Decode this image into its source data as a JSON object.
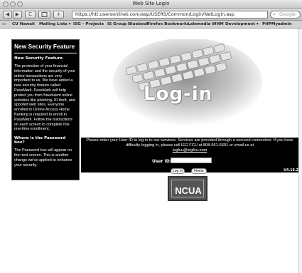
{
  "window": {
    "title": "Web Site Login"
  },
  "toolbar": {
    "url": "https://htt.usersonlinet.com/asp/USERS/Common/Login/NetLogin.asp",
    "search_placeholder": "Google",
    "back_label": "◀",
    "forward_label": "▶",
    "reload_label": "C",
    "add_label": "+"
  },
  "bookmarks": [
    {
      "label": "CU Hawaii"
    },
    {
      "label": "Mailing Lists ▾"
    },
    {
      "label": "ISG – Projects"
    },
    {
      "label": "IS Group Bluebook"
    },
    {
      "label": "Firefox Bookmarks"
    },
    {
      "label": "Lalemedia WHM"
    },
    {
      "label": "Development ▾"
    },
    {
      "label": "PHPMyadmin"
    }
  ],
  "sidebar": {
    "heading": "New Security Feature",
    "subheading_1": "New Security Feature",
    "body_1": "The protection of your financial information and the security of your online transactions are very important to us. We have added a new security feature called PassMark. PassMark will help protect you from fraudulent online activities like phishing, ID theft, and spoofed web sites. Everyone enrolled in Online Access Home Banking is required to enroll in PassMark. Follow the instructions on each screen to complete this one-time enrollment.",
    "subheading_2": "Where is the Password box?",
    "body_2": "The Password box will appear on the next screen. This is another change we've applied to enhance your security."
  },
  "hero": {
    "title": "Log-in"
  },
  "login": {
    "instructions": "Please enter your User ID to log in to our services. Services are provided through a secured connection. If you have difficulty logging in, please call IEG FCU at 808-961-6691 or email us at",
    "email": "iegfcu@iegfcu.com",
    "userid_label": "User ID:",
    "userid_value": "",
    "login_button": "Log In",
    "home_button": "Home",
    "version": "V4.16.2"
  },
  "badge": {
    "ncua_text": "NCUA"
  }
}
